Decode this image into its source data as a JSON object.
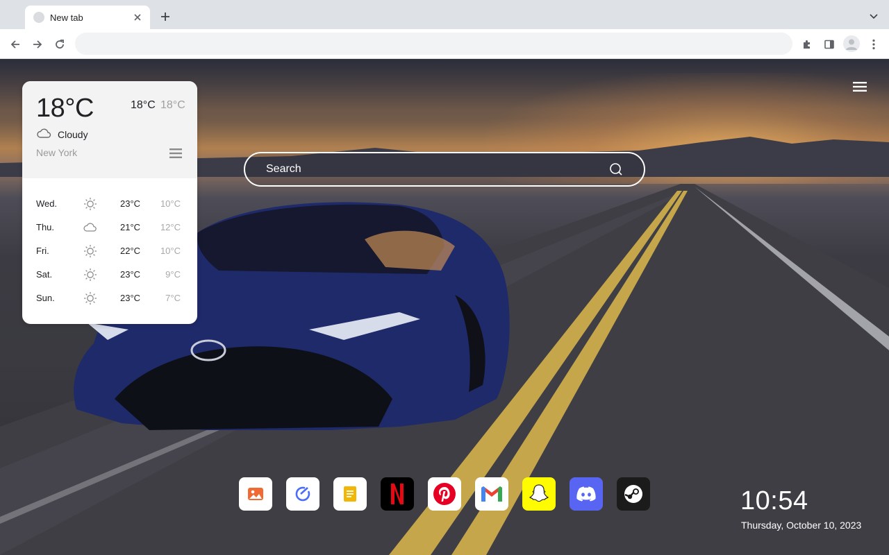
{
  "browser": {
    "tab_title": "New tab",
    "address_value": ""
  },
  "weather": {
    "current_temp": "18°C",
    "high": "18°C",
    "low": "18°C",
    "condition": "Cloudy",
    "condition_icon": "cloud-icon",
    "city": "New York",
    "forecast": [
      {
        "day": "Wed.",
        "icon": "sun-icon",
        "high": "23°C",
        "low": "10°C"
      },
      {
        "day": "Thu.",
        "icon": "cloud-icon",
        "high": "21°C",
        "low": "12°C"
      },
      {
        "day": "Fri.",
        "icon": "sun-icon",
        "high": "22°C",
        "low": "10°C"
      },
      {
        "day": "Sat.",
        "icon": "sun-icon",
        "high": "23°C",
        "low": "9°C"
      },
      {
        "day": "Sun.",
        "icon": "sun-icon",
        "high": "23°C",
        "low": "7°C"
      }
    ]
  },
  "search": {
    "placeholder": "Search"
  },
  "quick_links": [
    {
      "name": "gallery",
      "icon": "image-icon",
      "bg": "#ffffff",
      "fg": "#f06a35"
    },
    {
      "name": "tasks",
      "icon": "check-circle-icon",
      "bg": "#ffffff",
      "fg": "#4a6cf7"
    },
    {
      "name": "notes",
      "icon": "note-icon",
      "bg": "#ffffff",
      "fg": "#f2b705"
    },
    {
      "name": "netflix",
      "icon": "netflix-icon",
      "bg": "#000000",
      "fg": "#e50914"
    },
    {
      "name": "pinterest",
      "icon": "pinterest-icon",
      "bg": "#ffffff",
      "fg": "#e60023"
    },
    {
      "name": "gmail",
      "icon": "gmail-icon",
      "bg": "#ffffff",
      "fg": "#ea4335"
    },
    {
      "name": "snapchat",
      "icon": "snapchat-icon",
      "bg": "#fffc00",
      "fg": "#ffffff"
    },
    {
      "name": "discord",
      "icon": "discord-icon",
      "bg": "#5865f2",
      "fg": "#ffffff"
    },
    {
      "name": "steam",
      "icon": "steam-icon",
      "bg": "#1b1b1b",
      "fg": "#ffffff"
    }
  ],
  "clock": {
    "time": "10:54",
    "date": "Thursday, October 10, 2023"
  }
}
